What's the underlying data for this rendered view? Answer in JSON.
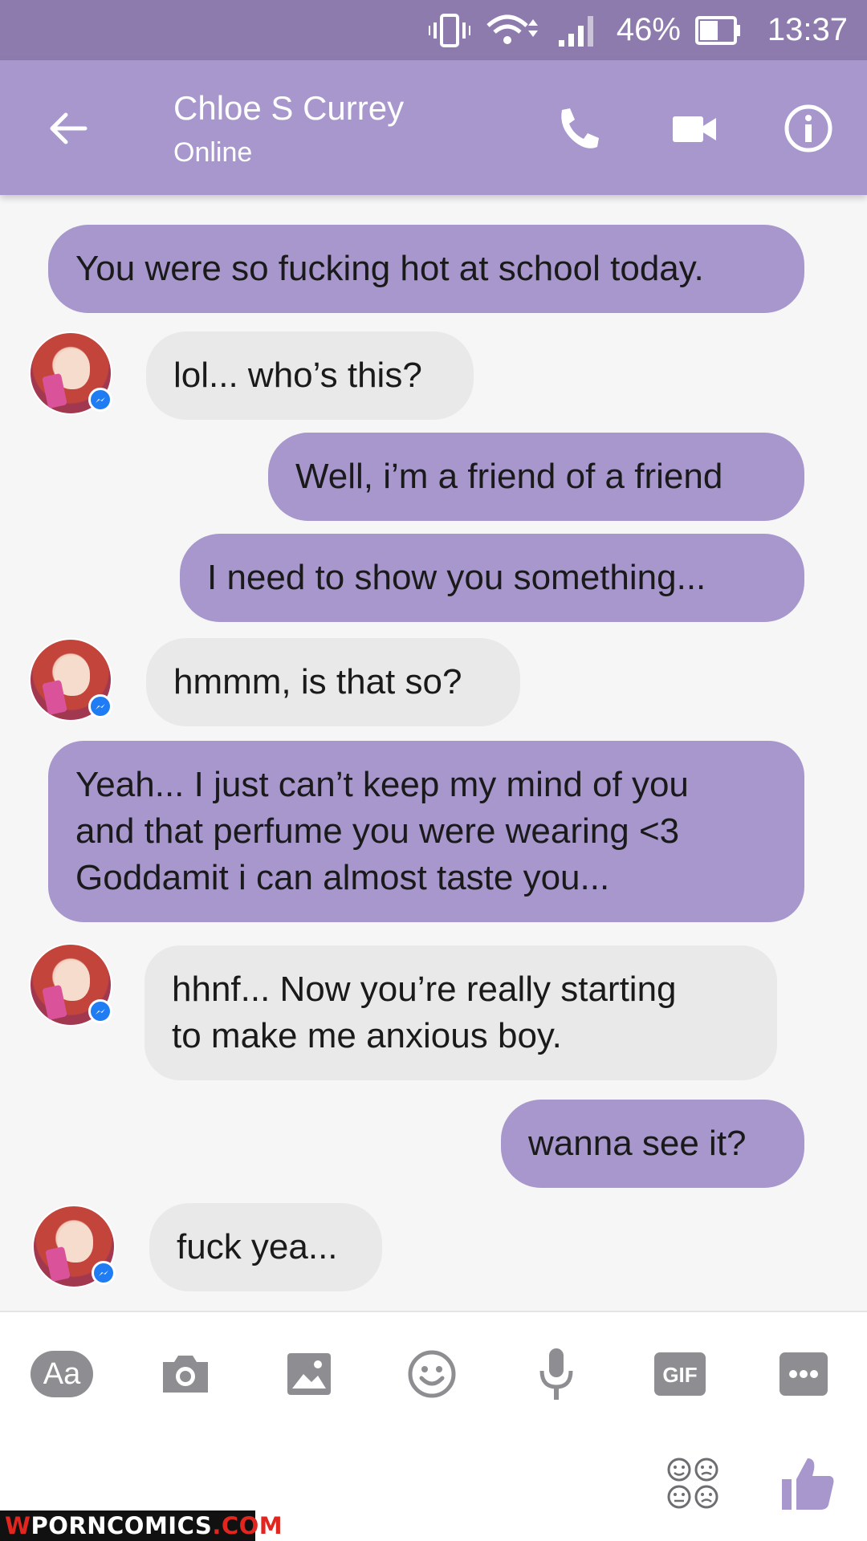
{
  "status_bar": {
    "battery": "46%",
    "time": "13:37"
  },
  "header": {
    "contact_name": "Chloe S Currey",
    "presence": "Online"
  },
  "messages": [
    {
      "dir": "out",
      "text": "You were so fucking hot at school today."
    },
    {
      "dir": "in",
      "text": "lol... who’s this?"
    },
    {
      "dir": "out",
      "text": "Well, i’m a friend of a friend"
    },
    {
      "dir": "out",
      "text": "I need to show you something..."
    },
    {
      "dir": "in",
      "text": "hmmm, is that so?"
    },
    {
      "dir": "out",
      "text": "Yeah... I just can’t keep my mind of you\nand that perfume you were wearing  <3\nGoddamit i can almost taste you..."
    },
    {
      "dir": "in",
      "text": "hhnf... Now you’re really starting\nto make me anxious boy."
    },
    {
      "dir": "out",
      "text": "wanna see it?"
    },
    {
      "dir": "in",
      "text": "fuck yea..."
    }
  ],
  "composer": {
    "text_button": "Aa",
    "tools": [
      "camera-icon",
      "image-icon",
      "emoji-icon",
      "microphone-icon",
      "gif-icon",
      "more-icon"
    ],
    "gif_label": "GIF"
  },
  "watermark": {
    "prefix": "W",
    "main": "PORNCOMICS",
    "suffix": ".COM"
  },
  "colors": {
    "header": "#a797cc",
    "status_bar": "#8d7bae",
    "outgoing": "#a797cc",
    "incoming": "#e9e9ea"
  }
}
